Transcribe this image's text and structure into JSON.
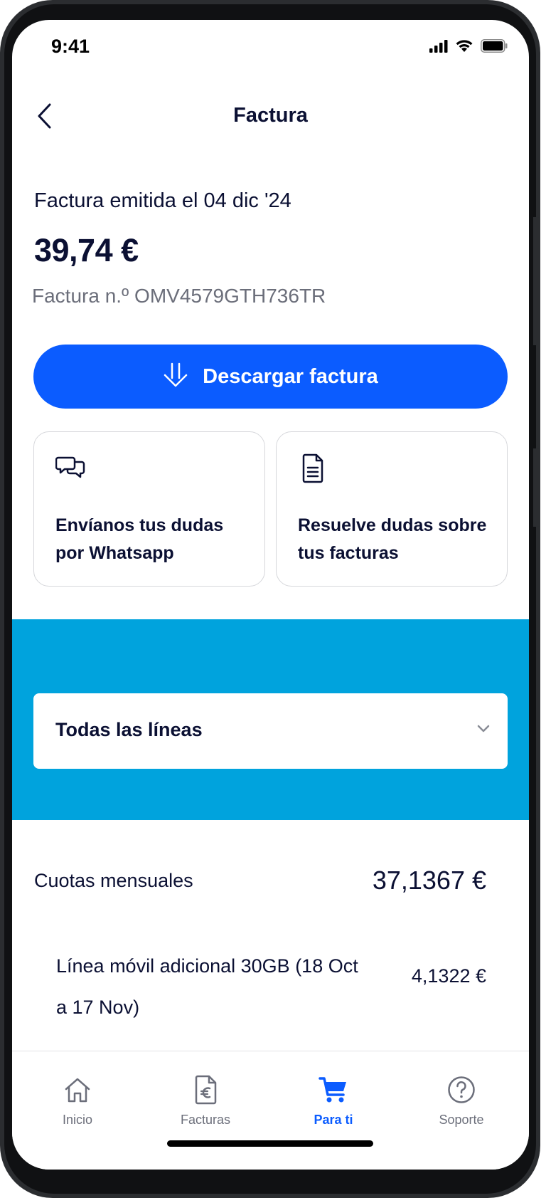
{
  "status_bar": {
    "time": "9:41",
    "icons": [
      "signal-icon",
      "wifi-icon",
      "battery-icon"
    ]
  },
  "header": {
    "title": "Factura",
    "back_icon": "chevron-left-icon"
  },
  "invoice": {
    "issued_label": "Factura emitida el 04 dic '24",
    "amount": "39,74 €",
    "number_label": "Factura n.º OMV4579GTH736TR"
  },
  "download_button": {
    "label": "Descargar factura",
    "icon": "download-icon"
  },
  "help_cards": [
    {
      "icon": "chat-bubbles-icon",
      "text": "Envíanos tus dudas por Whatsapp"
    },
    {
      "icon": "document-icon",
      "text": "Resuelve dudas sobre tus facturas"
    }
  ],
  "line_selector": {
    "selected": "Todas las líneas",
    "icon": "chevron-down-icon"
  },
  "monthly_fees": {
    "label": "Cuotas mensuales",
    "amount": "37,1367 €"
  },
  "line_items": [
    {
      "name": "Línea móvil adicional 30GB (18 Oct a 17 Nov)",
      "amount": "4,1322 €"
    }
  ],
  "tab_bar": {
    "tabs": [
      {
        "label": "Inicio",
        "icon": "home-icon",
        "active": false
      },
      {
        "label": "Facturas",
        "icon": "invoice-euro-icon",
        "active": false
      },
      {
        "label": "Para ti",
        "icon": "cart-icon",
        "active": true
      },
      {
        "label": "Soporte",
        "icon": "help-circle-icon",
        "active": false
      }
    ]
  },
  "colors": {
    "primary": "#0b5cff",
    "band": "#00a3dd",
    "text": "#0b1033",
    "muted": "#6b6e7a"
  }
}
